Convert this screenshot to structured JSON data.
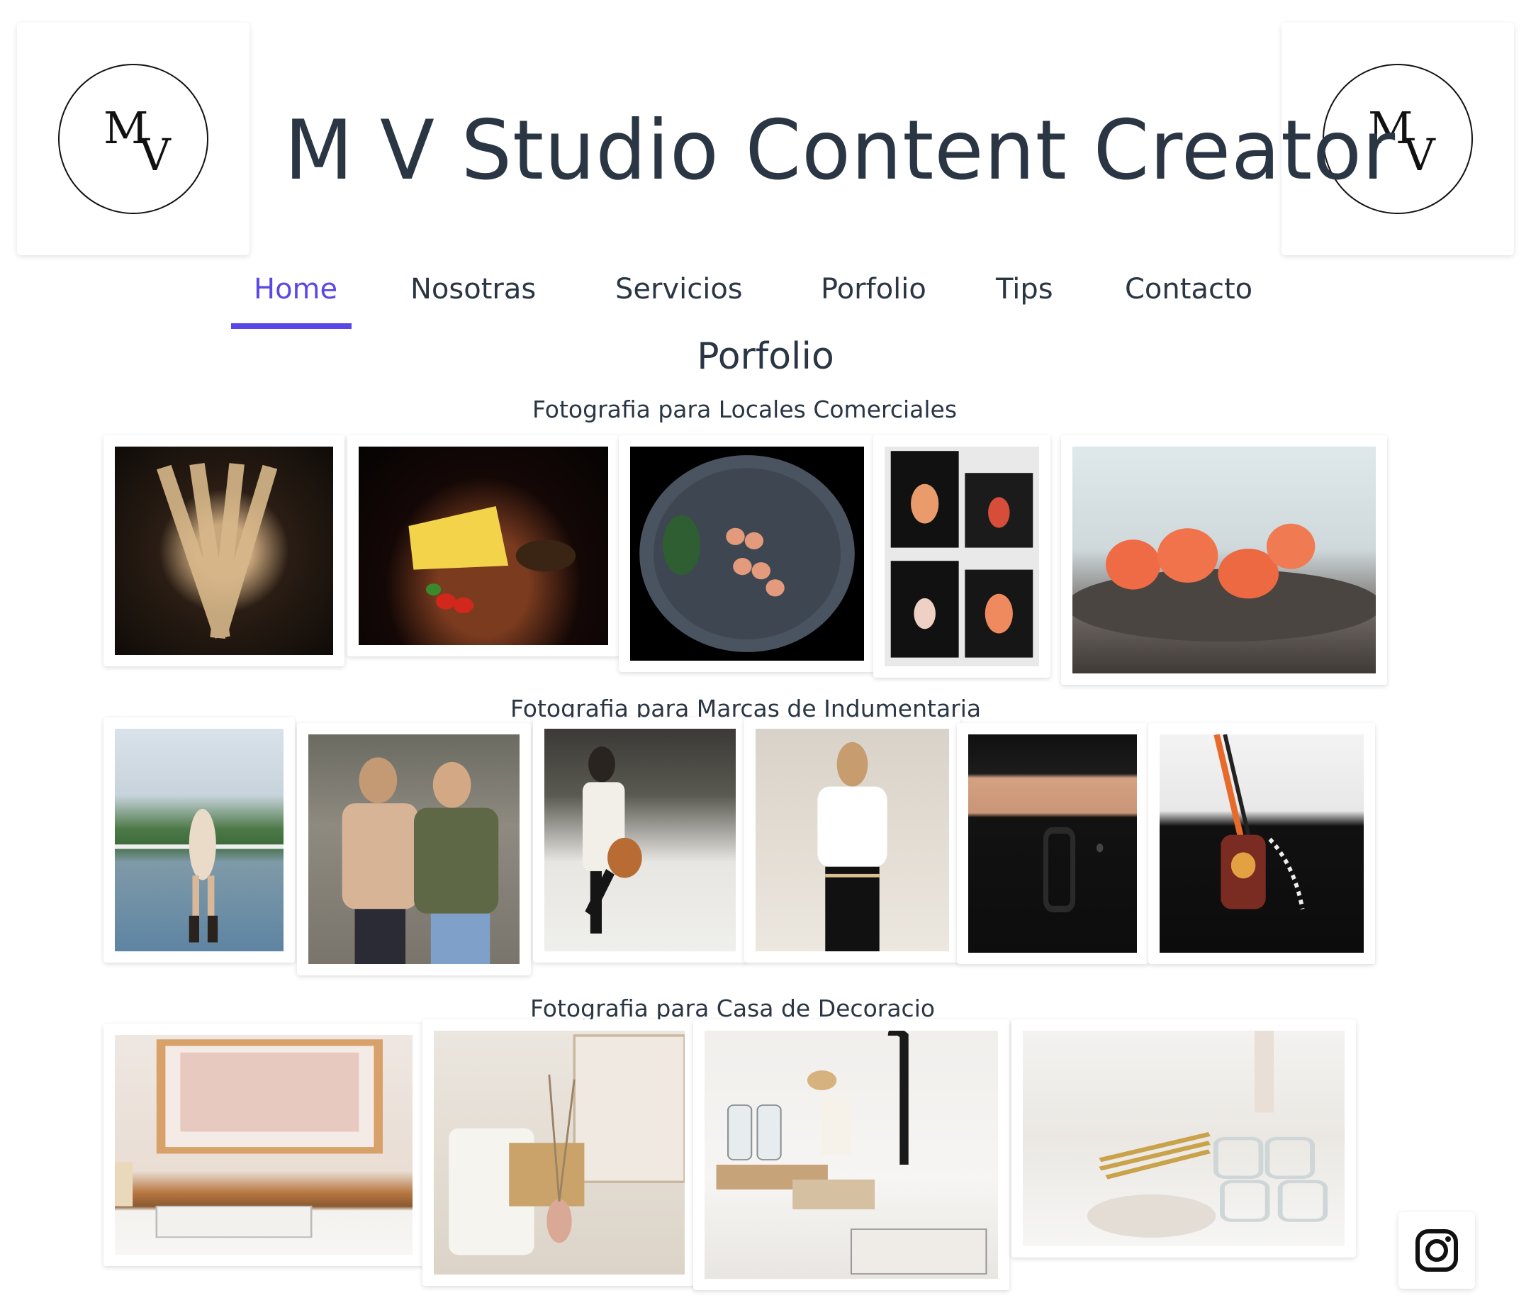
{
  "header": {
    "logo_text": "MV",
    "title": "M V Studio Content Creator"
  },
  "nav": {
    "items": [
      {
        "label": "Home",
        "active": true
      },
      {
        "label": "Nosotras",
        "active": false
      },
      {
        "label": "Servicios",
        "active": false
      },
      {
        "label": "Porfolio",
        "active": false
      },
      {
        "label": "Tips",
        "active": false
      },
      {
        "label": "Contacto",
        "active": false
      }
    ]
  },
  "main": {
    "heading": "Porfolio",
    "sections": [
      {
        "title": "Fotografia para Locales Comerciales"
      },
      {
        "title": "Fotografia para Marcas de Indumentaria"
      },
      {
        "title": "Fotografia para Casa de Decoracio"
      }
    ]
  },
  "social": {
    "icon": "instagram-icon"
  },
  "colors": {
    "accent": "#5a48e6",
    "text": "#2b3644"
  }
}
